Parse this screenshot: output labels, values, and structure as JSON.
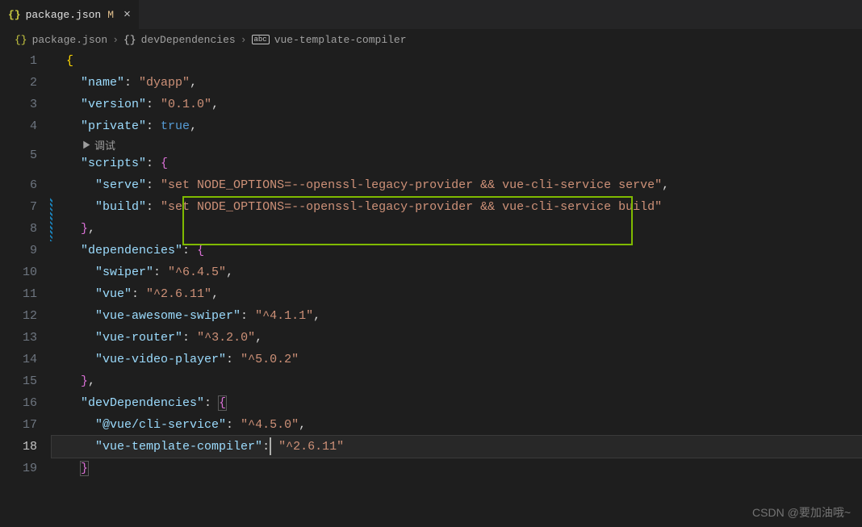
{
  "tab": {
    "icon": "{}",
    "filename": "package.json",
    "modified_marker": "M"
  },
  "breadcrumbs": {
    "file_icon": "{}",
    "file": "package.json",
    "section_icon": "{}",
    "section": "devDependencies",
    "symbol_icon": "abc",
    "symbol": "vue-template-compiler"
  },
  "codelens": {
    "label": "调试"
  },
  "code": {
    "name_key": "\"name\"",
    "name_val": "\"dyapp\"",
    "version_key": "\"version\"",
    "version_val": "\"0.1.0\"",
    "private_key": "\"private\"",
    "private_val": "true",
    "scripts_key": "\"scripts\"",
    "serve_key": "\"serve\"",
    "serve_val": "\"set NODE_OPTIONS=--openssl-legacy-provider && vue-cli-service serve\"",
    "build_key": "\"build\"",
    "build_val": "\"set NODE_OPTIONS=--openssl-legacy-provider && vue-cli-service build\"",
    "dependencies_key": "\"dependencies\"",
    "swiper_key": "\"swiper\"",
    "swiper_val": "\"^6.4.5\"",
    "vue_key": "\"vue\"",
    "vue_val": "\"^2.6.11\"",
    "vas_key": "\"vue-awesome-swiper\"",
    "vas_val": "\"^4.1.1\"",
    "vr_key": "\"vue-router\"",
    "vr_val": "\"^3.2.0\"",
    "vvp_key": "\"vue-video-player\"",
    "vvp_val": "\"^5.0.2\"",
    "devdeps_key": "\"devDependencies\"",
    "cli_key": "\"@vue/cli-service\"",
    "cli_val": "\"^4.5.0\"",
    "vtc_key": "\"vue-template-compiler\"",
    "vtc_val": "\"^2.6.11\""
  },
  "line_numbers": [
    "1",
    "2",
    "3",
    "4",
    "5",
    "6",
    "7",
    "8",
    "9",
    "10",
    "11",
    "12",
    "13",
    "14",
    "15",
    "16",
    "17",
    "18",
    "19"
  ],
  "watermark": "CSDN @要加油哦~"
}
